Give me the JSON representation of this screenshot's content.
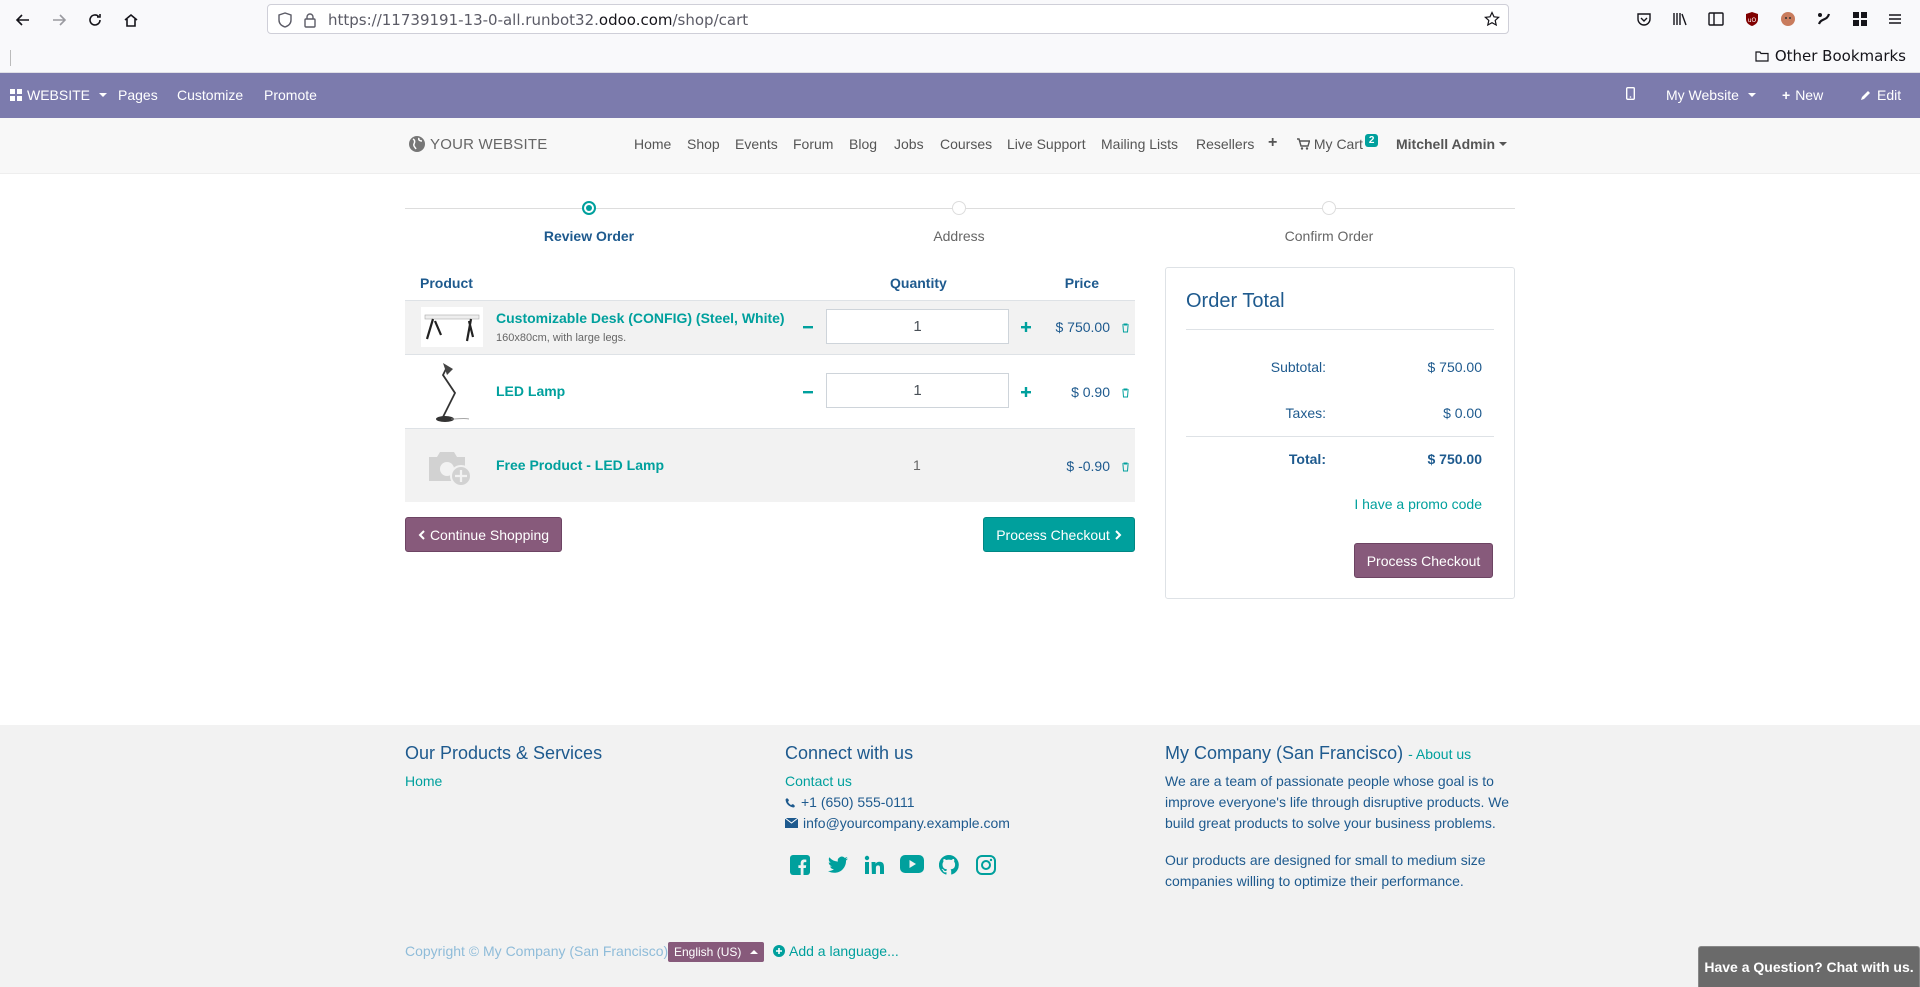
{
  "browser": {
    "url_prefix": "https://11739191-13-0-all.runbot32.",
    "url_domain": "odoo.com",
    "url_path": "/shop/cart",
    "other_bookmarks": "Other Bookmarks"
  },
  "odoo_bar": {
    "app": "WEBSITE",
    "pages": "Pages",
    "customize": "Customize",
    "promote": "Promote",
    "my_website": "My Website",
    "new": "New",
    "edit": "Edit"
  },
  "header": {
    "logo": "YOUR WEBSITE",
    "menu": [
      "Home",
      "Shop",
      "Events",
      "Forum",
      "Blog",
      "Jobs",
      "Courses",
      "Live Support",
      "Mailing Lists",
      "Resellers"
    ],
    "cart_label": "My Cart",
    "cart_count": "2",
    "user": "Mitchell Admin"
  },
  "wizard": {
    "steps": [
      "Review Order",
      "Address",
      "Confirm Order"
    ],
    "active_step": 0
  },
  "cart": {
    "headers": {
      "product": "Product",
      "quantity": "Quantity",
      "price": "Price"
    },
    "lines": [
      {
        "name": "Customizable Desk (CONFIG) (Steel, White)",
        "description": "160x80cm, with large legs.",
        "quantity": "1",
        "price": "$ 750.00"
      },
      {
        "name": "LED Lamp",
        "quantity": "1",
        "price": "$ 0.90"
      },
      {
        "name": "Free Product - LED Lamp",
        "quantity": "1",
        "price": "$ -0.90"
      }
    ],
    "continue_shopping": "Continue Shopping",
    "process_checkout": "Process Checkout"
  },
  "order_total": {
    "title": "Order Total",
    "subtotal_label": "Subtotal:",
    "subtotal": "$ 750.00",
    "taxes_label": "Taxes:",
    "taxes": "$ 0.00",
    "total_label": "Total:",
    "total": "$ 750.00",
    "promo": "I have a promo code",
    "checkout": "Process Checkout"
  },
  "footer": {
    "products_title": "Our Products & Services",
    "products_link": "Home",
    "connect_title": "Connect with us",
    "contact_us": "Contact us",
    "phone": "+1 (650) 555-0111",
    "email": "info@yourcompany.example.com",
    "company_title": "My Company (San Francisco)",
    "about_link": "- About us",
    "about_text_1": "We are a team of passionate people whose goal is to improve everyone's life through disruptive products. We build great products to solve your business problems.",
    "about_text_2": "Our products are designed for small to medium size companies willing to optimize their performance.",
    "copyright": "Copyright © My Company (San Francisco)",
    "language": "English (US)",
    "add_language": "Add a language..."
  },
  "chat": "Have a Question? Chat with us.",
  "colors": {
    "odoo_purple": "#7c7bad",
    "teal": "#00a09d",
    "dark_blue": "#1e5a8e",
    "button_purple": "#875a7b"
  }
}
